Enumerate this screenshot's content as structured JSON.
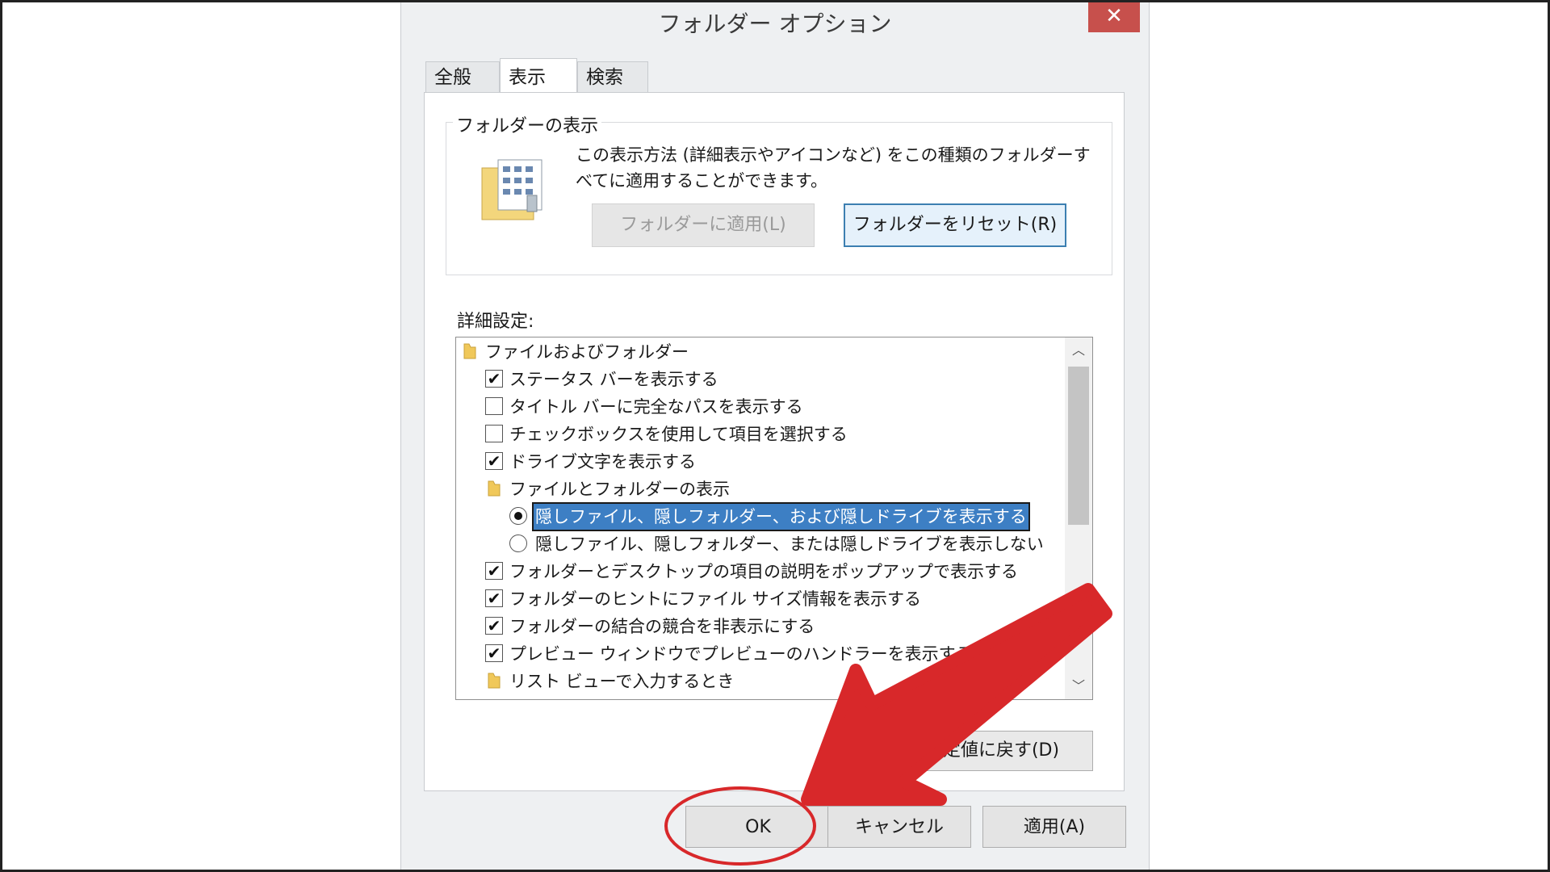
{
  "dialog": {
    "title": "フォルダー オプション",
    "close_glyph": "✕"
  },
  "tabs": [
    {
      "label": "全般",
      "active": false
    },
    {
      "label": "表示",
      "active": true
    },
    {
      "label": "検索",
      "active": false
    }
  ],
  "folder_views": {
    "group_title": "フォルダーの表示",
    "description": "この表示方法 (詳細表示やアイコンなど) をこの種類のフォルダーすべてに適用することができます。",
    "apply_button": "フォルダーに適用(L)",
    "reset_button": "フォルダーをリセット(R)"
  },
  "advanced": {
    "label": "詳細設定:",
    "items": [
      {
        "type": "folder",
        "label": "ファイルおよびフォルダー",
        "indent": 0
      },
      {
        "type": "checkbox",
        "checked": true,
        "label": "ステータス バーを表示する",
        "indent": 1
      },
      {
        "type": "checkbox",
        "checked": false,
        "label": "タイトル バーに完全なパスを表示する",
        "indent": 1
      },
      {
        "type": "checkbox",
        "checked": false,
        "label": "チェックボックスを使用して項目を選択する",
        "indent": 1
      },
      {
        "type": "checkbox",
        "checked": true,
        "label": "ドライブ文字を表示する",
        "indent": 1
      },
      {
        "type": "folder",
        "label": "ファイルとフォルダーの表示",
        "indent": 1
      },
      {
        "type": "radio",
        "checked": true,
        "selected": true,
        "label": "隠しファイル、隠しフォルダー、および隠しドライブを表示する",
        "indent": 2
      },
      {
        "type": "radio",
        "checked": false,
        "label": "隠しファイル、隠しフォルダー、または隠しドライブを表示しない",
        "indent": 2
      },
      {
        "type": "checkbox",
        "checked": true,
        "label": "フォルダーとデスクトップの項目の説明をポップアップで表示する",
        "indent": 1
      },
      {
        "type": "checkbox",
        "checked": true,
        "label": "フォルダーのヒントにファイル サイズ情報を表示する",
        "indent": 1
      },
      {
        "type": "checkbox",
        "checked": true,
        "label": "フォルダーの結合の競合を非表示にする",
        "indent": 1
      },
      {
        "type": "checkbox",
        "checked": true,
        "label": "プレビュー ウィンドウでプレビューのハンドラーを表示する",
        "indent": 1
      },
      {
        "type": "folder",
        "label": "リスト ビューで入力するとき",
        "indent": 1
      }
    ],
    "restore_button": "既定値に戻す(D)"
  },
  "footer": {
    "ok_button": "OK",
    "cancel_button": "キャンセル",
    "apply_button": "適用(A)"
  },
  "colors": {
    "annotation_red": "#d8282a",
    "selection_blue": "#3d7fc4",
    "close_red": "#c7504c"
  }
}
